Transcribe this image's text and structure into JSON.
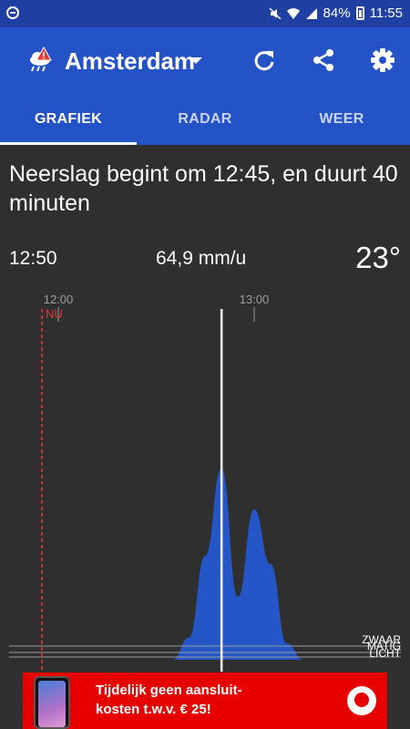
{
  "status_bar": {
    "battery": "84%",
    "time": "11:55"
  },
  "app_bar": {
    "city": "Amsterdam",
    "icons": [
      "weather-warning-icon",
      "refresh-icon",
      "share-icon",
      "settings-icon"
    ]
  },
  "tabs": [
    {
      "label": "GRAFIEK",
      "active": true
    },
    {
      "label": "RADAR",
      "active": false
    },
    {
      "label": "WEER",
      "active": false
    }
  ],
  "forecast": {
    "headline": "Neerslag begint om 12:45, en duurt 40 minuten",
    "cursor_time": "12:50",
    "cursor_rate": "64,9 mm/u",
    "temperature": "23°"
  },
  "chart_data": {
    "type": "area",
    "x_tick_labels": [
      "12:00",
      "13:00"
    ],
    "now_label": "NU",
    "intensity_labels": [
      "ZWAAR",
      "MATIG",
      "LICHT"
    ],
    "x": [
      "12:00",
      "12:05",
      "12:10",
      "12:15",
      "12:20",
      "12:25",
      "12:30",
      "12:35",
      "12:40",
      "12:45",
      "12:50",
      "12:55",
      "13:00",
      "13:05",
      "13:10",
      "13:15",
      "13:20"
    ],
    "y": [
      0,
      0,
      0,
      0,
      0,
      0,
      0,
      0,
      8,
      38,
      70,
      23,
      55,
      35,
      6,
      0,
      0
    ],
    "colors": {
      "fill": "#2456c8",
      "now_line": "#e53935",
      "cursor": "#ffffff",
      "grid": "#9e9e9e"
    }
  },
  "ad": {
    "line1": "Tijdelijk geen aansluit-",
    "line2": "kosten t.w.v. € 25!"
  }
}
